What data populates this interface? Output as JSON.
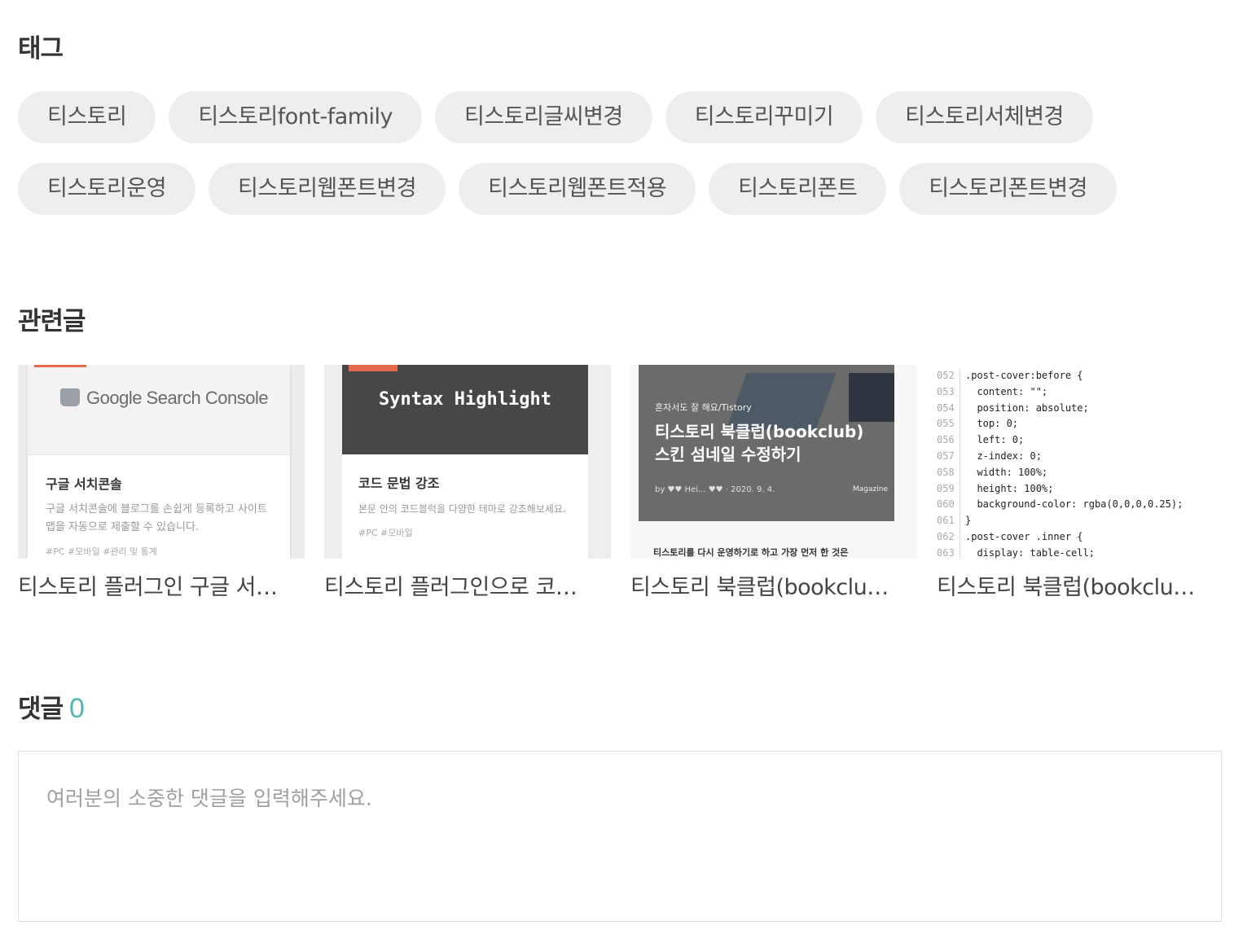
{
  "tags_section": {
    "title": "태그",
    "rows": [
      [
        "티스토리",
        "티스토리font-family",
        "티스토리글씨변경",
        "티스토리꾸미기",
        "티스토리서체변경"
      ],
      [
        "티스토리운영",
        "티스토리웹폰트변경",
        "티스토리웹폰트적용",
        "티스토리폰트",
        "티스토리폰트변경"
      ]
    ]
  },
  "related_section": {
    "title": "관련글",
    "items": [
      {
        "title": "티스토리 플러그인 구글 서치콘솔",
        "thumb": {
          "header": "Google Search Console",
          "card_title": "구글 서치콘솔",
          "card_desc": "구글 서치콘솔에 블로그를 손쉽게 등록하고 사이트맵을 자동으로 제출할 수 있습니다.",
          "card_tags": "#PC  #모바일  #관리 및 통계"
        }
      },
      {
        "title": "티스토리 플러그인으로 코드 문법 강조",
        "thumb": {
          "header": "Syntax Highlight",
          "card_title": "코드 문법 강조",
          "card_desc": "본문 안의 코드블럭을 다양한 테마로 강조해보세요.",
          "card_tags": "#PC  #모바일"
        }
      },
      {
        "title": "티스토리 북클럽(bookclub) 스킨 섬네일 수정하기",
        "thumb": {
          "small": "혼자서도 잘 해요/Tistory",
          "headline_1": "티스토리 북클럽(bookclub)",
          "headline_2": "스킨 섬네일 수정하기",
          "byline": "by ♥♥ Hei... ♥♥ · 2020. 9. 4.",
          "magazine": "Magazine",
          "bottom": "티스토리를 다시 운영하기로 하고 가장 먼저 한 것은"
        }
      },
      {
        "title": "티스토리 북클럽(bookclub) 스킨 커버 수정하기",
        "thumb": {
          "code_lines": [
            {
              "n": "052",
              "code": ".post-cover:before {"
            },
            {
              "n": "053",
              "code": "  content: \"\";"
            },
            {
              "n": "054",
              "code": "  position: absolute;"
            },
            {
              "n": "055",
              "code": "  top: 0;"
            },
            {
              "n": "056",
              "code": "  left: 0;"
            },
            {
              "n": "057",
              "code": "  z-index: 0;"
            },
            {
              "n": "058",
              "code": "  width: 100%;"
            },
            {
              "n": "059",
              "code": "  height: 100%;"
            },
            {
              "n": "060",
              "code": "  background-color: rgba(0,0,0,0.25);"
            },
            {
              "n": "061",
              "code": "}"
            },
            {
              "n": "062",
              "code": ".post-cover .inner {"
            },
            {
              "n": "063",
              "code": "  display: table-cell;"
            }
          ]
        }
      }
    ]
  },
  "comments_section": {
    "title": "댓글",
    "count": "0",
    "placeholder": "여러분의 소중한 댓글을 입력해주세요."
  },
  "colors": {
    "accent": "#4fb4b2",
    "tag_bg": "#eeeeee",
    "text": "#333333"
  }
}
